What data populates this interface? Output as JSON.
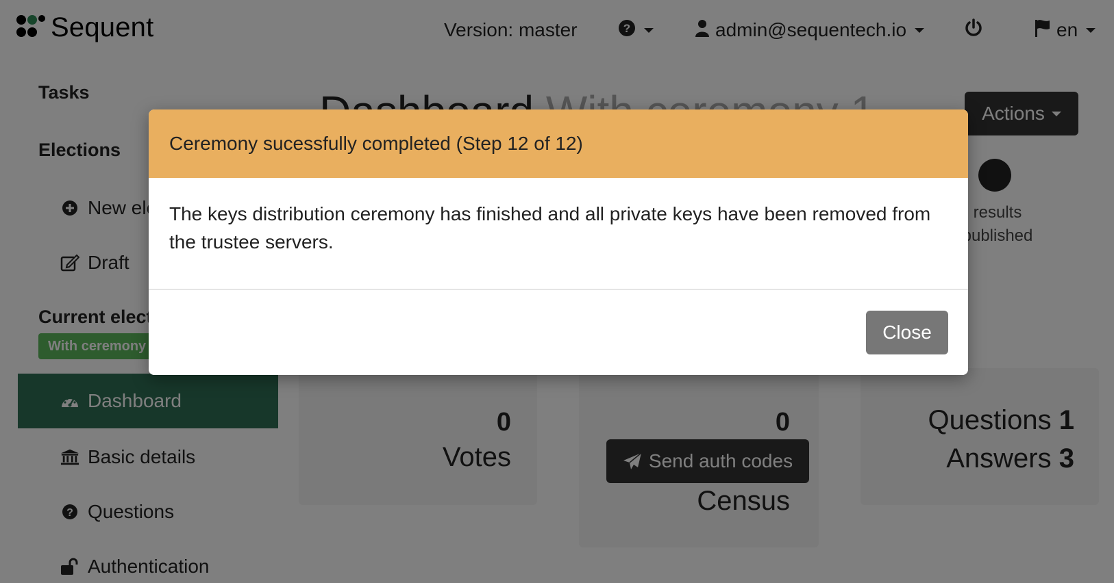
{
  "brand": {
    "name": "Sequent"
  },
  "navbar": {
    "version_label": "Version: master",
    "help_icon": "question-circle-icon",
    "user_email": "admin@sequentech.io",
    "user_icon": "user-icon",
    "power_icon": "power-icon",
    "language": "en",
    "flag_icon": "flag-icon"
  },
  "sidebar": {
    "tasks_heading": "Tasks",
    "elections_heading": "Elections",
    "new_election_label": "New election",
    "draft_label": "Draft",
    "current_election_heading": "Current election",
    "current_election_badge": "With ceremony 1",
    "items": [
      {
        "label": "Dashboard",
        "icon": "dashboard-icon",
        "active": true
      },
      {
        "label": "Basic details",
        "icon": "institution-icon"
      },
      {
        "label": "Questions",
        "icon": "question-circle-icon"
      },
      {
        "label": "Authentication",
        "icon": "unlock-icon"
      }
    ]
  },
  "main": {
    "title": "Dashboard",
    "title_sub": "With ceremony 1",
    "actions_label": "Actions",
    "step_label_line1": "results",
    "step_label_line2": "published",
    "votes": {
      "count": "0",
      "label": "Votes"
    },
    "census": {
      "count": "0",
      "button_label": "Send auth codes",
      "label": "Census"
    },
    "questions": {
      "questions_label": "Questions",
      "questions_count": "1",
      "answers_label": "Answers",
      "answers_count": "3"
    }
  },
  "modal": {
    "title": "Ceremony sucessfully completed (Step 12 of 12)",
    "body": "The keys distribution ceremony has finished and all private keys have been removed from the trustee servers.",
    "close_label": "Close",
    "header_color": "#e9af5f"
  }
}
